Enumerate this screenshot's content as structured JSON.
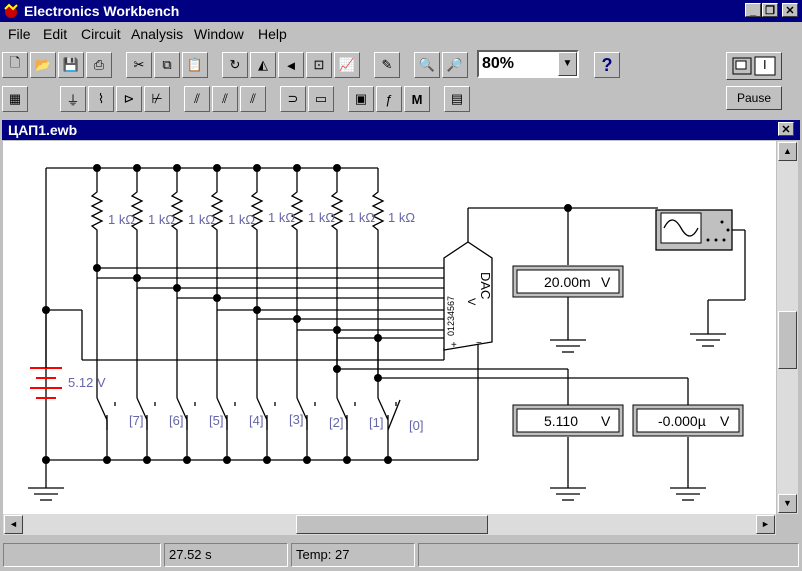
{
  "app": {
    "title": "Electronics Workbench"
  },
  "menu": {
    "items": [
      "File",
      "Edit",
      "Circuit",
      "Analysis",
      "Window",
      "Help"
    ]
  },
  "toolbar": {
    "zoom": "80%",
    "help_label": "?",
    "pause_label": "Pause",
    "power_label": "I"
  },
  "document": {
    "title": "ЦАП1.ewb"
  },
  "circuit": {
    "resistor_label": "1 kΩ",
    "resistor_labels": [
      "1 kΩ",
      "1 kΩ",
      "1 kΩ",
      "1 kΩ",
      "1 kΩ",
      "1 kΩ",
      "1 kΩ",
      "1 kΩ"
    ],
    "battery_label": "5.12 V",
    "switch_keys": [
      "[7]",
      "[6]",
      "[5]",
      "[4]",
      "[3]",
      "[2]",
      "[1]",
      "[0]"
    ],
    "dac_label": "DAC",
    "dac_sub": "V",
    "dac_pins": "01234567",
    "meter_top": {
      "value": "20.00m",
      "unit": "V"
    },
    "meter_mid": {
      "value": "5.110",
      "unit": "V"
    },
    "meter_right": {
      "value": "-0.000µ",
      "unit": "V"
    }
  },
  "status": {
    "time": "27.52 s",
    "temp": "Temp:  27"
  },
  "colors": {
    "title_bar": "#000080",
    "chrome": "#c0c0c0",
    "label_blue": "#6666aa",
    "battery_red": "#ff0000"
  }
}
